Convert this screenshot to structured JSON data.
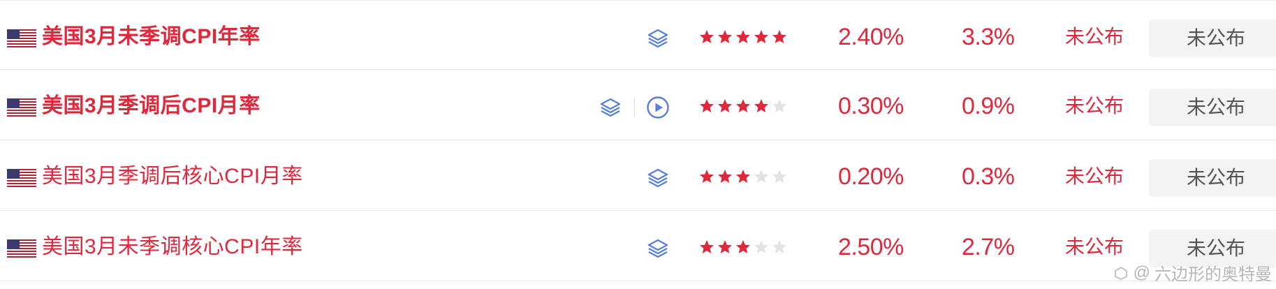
{
  "rows": [
    {
      "flag_icon": "us-flag-icon",
      "title": "美国3月未季调CPI年率",
      "bold": true,
      "has_video": false,
      "stars": 5,
      "stars_max": 5,
      "previous": "2.40%",
      "forecast": "3.3%",
      "actual": "未公布",
      "button_label": "未公布"
    },
    {
      "flag_icon": "us-flag-icon",
      "title": "美国3月季调后CPI月率",
      "bold": true,
      "has_video": true,
      "stars": 4,
      "stars_max": 5,
      "previous": "0.30%",
      "forecast": "0.9%",
      "actual": "未公布",
      "button_label": "未公布"
    },
    {
      "flag_icon": "us-flag-icon",
      "title": "美国3月季调后核心CPI月率",
      "bold": false,
      "has_video": false,
      "stars": 3,
      "stars_max": 5,
      "previous": "0.20%",
      "forecast": "0.3%",
      "actual": "未公布",
      "button_label": "未公布"
    },
    {
      "flag_icon": "us-flag-icon",
      "title": "美国3月未季调核心CPI年率",
      "bold": false,
      "has_video": false,
      "stars": 3,
      "stars_max": 5,
      "previous": "2.50%",
      "forecast": "2.7%",
      "actual": "未公布",
      "button_label": "未公布"
    }
  ],
  "watermark": {
    "prefix": "@",
    "text": "六边形的奥特曼"
  },
  "colors": {
    "accent": "#e0283c",
    "icon_blue": "#5b7fd6",
    "star_empty": "#e3e3e3",
    "button_bg": "#f3f3f3"
  }
}
